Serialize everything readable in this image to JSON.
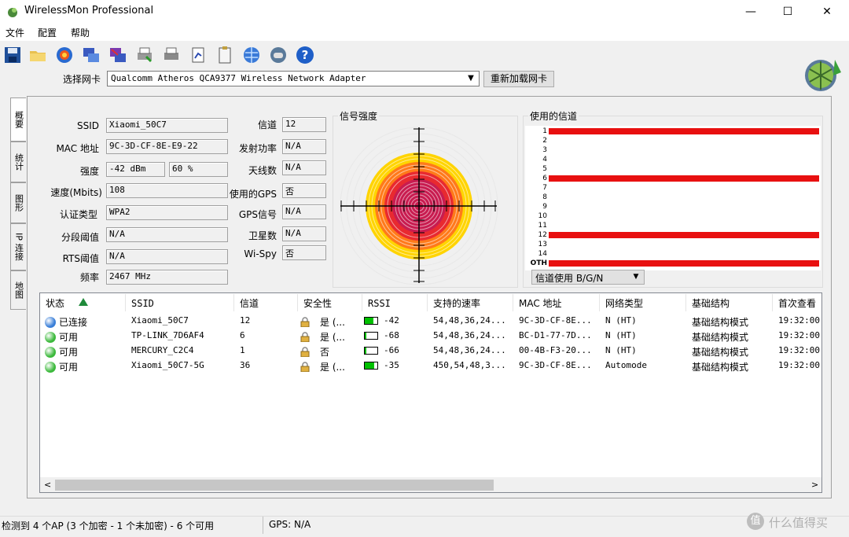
{
  "window": {
    "title": "WirelessMon Professional",
    "controls": [
      "—",
      "☐",
      "✕"
    ]
  },
  "menu": [
    "文件",
    "配置",
    "帮助"
  ],
  "toolbar": {
    "adapter_label": "选择网卡",
    "adapter_value": "Qualcomm Atheros QCA9377 Wireless Network Adapter",
    "reload_label": "重新加载网卡"
  },
  "side_tabs": [
    "概要",
    "统计",
    "图形",
    "IP 连接",
    "地图"
  ],
  "summary": {
    "ssid_label": "SSID",
    "ssid": "Xiaomi_50C7",
    "mac_label": "MAC 地址",
    "mac": "9C-3D-CF-8E-E9-22",
    "strength_label": "强度",
    "strength_dbm": "-42 dBm",
    "strength_pct": "60 %",
    "speed_label": "速度(Mbits)",
    "speed": "108",
    "auth_label": "认证类型",
    "auth": "WPA2",
    "frag_label": "分段阈值",
    "frag": "N/A",
    "rts_label": "RTS阈值",
    "rts": "N/A",
    "freq_label": "频率",
    "freq": "2467 MHz",
    "channel_label": "信道",
    "channel": "12",
    "txpower_label": "发射功率",
    "txpower": "N/A",
    "antenna_label": "天线数",
    "antenna": "N/A",
    "gps_used_label": "使用的GPS",
    "gps_used": "否",
    "gps_signal_label": "GPS信号",
    "gps_signal": "N/A",
    "satellites_label": "卫星数",
    "satellites": "N/A",
    "wispy_label": "Wi-Spy",
    "wispy": "否"
  },
  "signal_panel": {
    "title": "信号强度"
  },
  "channels_panel": {
    "title": "使用的信道",
    "labels": [
      "1",
      "2",
      "3",
      "4",
      "5",
      "6",
      "7",
      "8",
      "9",
      "10",
      "11",
      "12",
      "13",
      "14",
      "OTH"
    ],
    "used": [
      1,
      6,
      12,
      15
    ],
    "used_color": "#e81010",
    "dropdown": "信道使用 B/G/N"
  },
  "list": {
    "columns": [
      "状态",
      "SSID",
      "信道",
      "安全性",
      "RSSI",
      "支持的速率",
      "MAC 地址",
      "网络类型",
      "基础结构",
      "首次查看"
    ],
    "rows": [
      {
        "status": "已连接",
        "dot": "#3a7fd8",
        "ssid": "Xiaomi_50C7",
        "channel": "12",
        "sec": "是 (...",
        "rssi": "-42",
        "rssi_level": 0.7,
        "rates": "54,48,36,24...",
        "mac": "9C-3D-CF-8E...",
        "type": "N (HT)",
        "infra": "基础结构模式",
        "first": "19:32:00"
      },
      {
        "status": "可用",
        "dot": "#3cb93c",
        "ssid": "TP-LINK_7D6AF4",
        "channel": "6",
        "sec": "是 (...",
        "rssi": "-68",
        "rssi_level": 0.15,
        "rates": "54,48,36,24...",
        "mac": "BC-D1-77-7D...",
        "type": "N (HT)",
        "infra": "基础结构模式",
        "first": "19:32:00"
      },
      {
        "status": "可用",
        "dot": "#3cb93c",
        "ssid": "MERCURY_C2C4",
        "channel": "1",
        "sec": "否",
        "rssi": "-66",
        "rssi_level": 0.15,
        "rates": "54,48,36,24...",
        "mac": "00-4B-F3-20...",
        "type": "N (HT)",
        "infra": "基础结构模式",
        "first": "19:32:00"
      },
      {
        "status": "可用",
        "dot": "#3cb93c",
        "ssid": "Xiaomi_50C7-5G",
        "channel": "36",
        "sec": "是 (...",
        "rssi": "-35",
        "rssi_level": 0.75,
        "rates": "450,54,48,3...",
        "mac": "9C-3D-CF-8E...",
        "type": "Automode",
        "infra": "基础结构模式",
        "first": "19:32:00"
      }
    ]
  },
  "status": {
    "left": "检测到 4 个AP (3 个加密 - 1 个未加密) - 6 个可用",
    "gps": "GPS: N/A",
    "watermark": "什么值得买"
  }
}
